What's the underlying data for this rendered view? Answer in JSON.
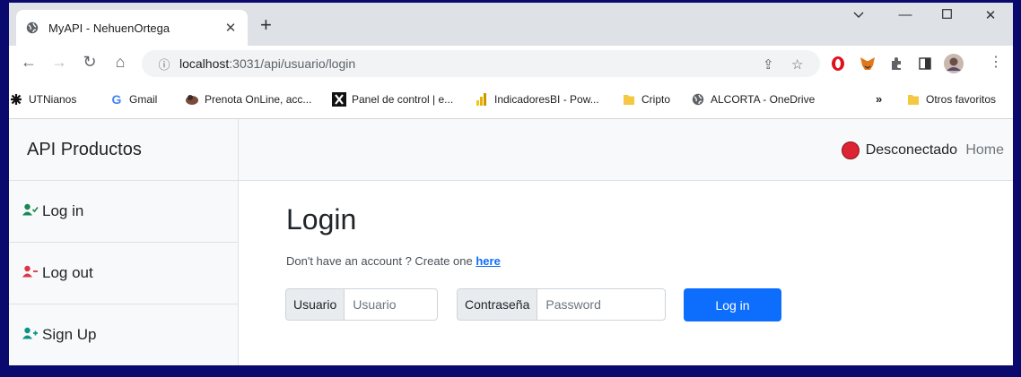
{
  "browser": {
    "tab_title": "MyAPI - NehuenOrtega",
    "url_host": "localhost",
    "url_path": ":3031/api/usuario/login",
    "bookmarks": [
      {
        "label": "UTNianos",
        "icon": "utn-icon"
      },
      {
        "label": "Gmail",
        "icon": "google-icon"
      },
      {
        "label": "Prenota OnLine, acc...",
        "icon": "prenota-icon"
      },
      {
        "label": "Panel de control | e...",
        "icon": "x-logo-icon"
      },
      {
        "label": "IndicadoresBI - Pow...",
        "icon": "powerbi-icon"
      },
      {
        "label": "Cripto",
        "icon": "folder-icon"
      },
      {
        "label": "ALCORTA - OneDrive",
        "icon": "globe-icon"
      },
      {
        "label": "Otros favoritos",
        "icon": "folder-icon"
      }
    ],
    "bookmarks_overflow": "»"
  },
  "app": {
    "brand": "API Productos",
    "sidebar": [
      {
        "label": "Log in",
        "icon": "user-check-icon",
        "color": "#198754"
      },
      {
        "label": "Log out",
        "icon": "user-minus-icon",
        "color": "#dc3545"
      },
      {
        "label": "Sign Up",
        "icon": "user-plus-icon",
        "color": "#0d9488"
      }
    ],
    "status_text": "Desconectado",
    "status_color": "#dc2433",
    "home_link": "Home"
  },
  "login": {
    "title": "Login",
    "subtitle_prefix": "Don't have an account ? Create one",
    "subtitle_link": "here",
    "user_label": "Usuario",
    "user_placeholder": "Usuario",
    "password_label": "Contraseña",
    "password_placeholder": "Password",
    "submit_label": "Log in",
    "accent": "#0d6efd"
  }
}
